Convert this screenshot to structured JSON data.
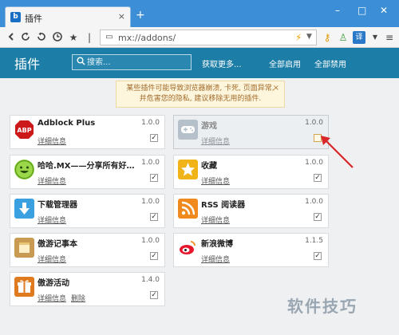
{
  "tab": {
    "logo": "b",
    "title": "插件",
    "close": "×"
  },
  "newtab": "+",
  "window_controls": {
    "minimize": "–",
    "maximize": "□",
    "close": "✕"
  },
  "toolbar": {
    "url": "mx://addons/",
    "icons": [
      "back-arrow-icon",
      "refresh-icon",
      "undo-icon",
      "history-icon",
      "star-icon",
      "page-icon",
      "lightning-icon",
      "key-icon",
      "user-icon",
      "translate-icon",
      "menu-icon"
    ]
  },
  "header": {
    "title": "插件",
    "search_placeholder": "搜索...",
    "get_more": "获取更多...",
    "enable_all": "全部启用",
    "disable_all": "全部禁用"
  },
  "notice": {
    "line1": "某些插件可能导致浏览器崩溃, 卡死, 页面异常,",
    "line2": "并危害您的隐私, 建议移除无用的插件.",
    "close": "×"
  },
  "plugins": [
    {
      "name": "Adblock Plus",
      "version": "1.0.0",
      "details": "详细信息",
      "enabled": true,
      "icon": "abp-icon",
      "color": "#cc1a1a"
    },
    {
      "name": "游戏",
      "version": "1.0.0",
      "details": "详细信息",
      "enabled": false,
      "icon": "gamepad-icon",
      "color": "#9aa5b0"
    },
    {
      "name": "哈哈.MX——分享所有好笑的...",
      "version": "1.0.0",
      "details": "详细信息",
      "enabled": true,
      "icon": "smiley-icon",
      "color": "#8ccf3b"
    },
    {
      "name": "收藏",
      "version": "1.0.0",
      "details": "详细信息",
      "enabled": true,
      "icon": "star-icon",
      "color": "#f0b419"
    },
    {
      "name": "下载管理器",
      "version": "1.0.0",
      "details": "详细信息",
      "enabled": true,
      "icon": "download-icon",
      "color": "#3aa0e0"
    },
    {
      "name": "RSS 阅读器",
      "version": "1.0.0",
      "details": "详细信息",
      "enabled": true,
      "icon": "rss-icon",
      "color": "#f08a1e"
    },
    {
      "name": "傲游记事本",
      "version": "1.0.0",
      "details": "详细信息",
      "enabled": true,
      "icon": "notepad-icon",
      "color": "#c89a52"
    },
    {
      "name": "新浪微博",
      "version": "1.1.5",
      "details": "详细信息",
      "enabled": true,
      "icon": "weibo-icon",
      "color": "#e6162d"
    },
    {
      "name": "傲游活动",
      "version": "1.4.0",
      "details": "详细信息",
      "remove": "删除",
      "enabled": true,
      "icon": "gift-icon",
      "color": "#e07a1e"
    }
  ],
  "watermark": "软件技巧"
}
